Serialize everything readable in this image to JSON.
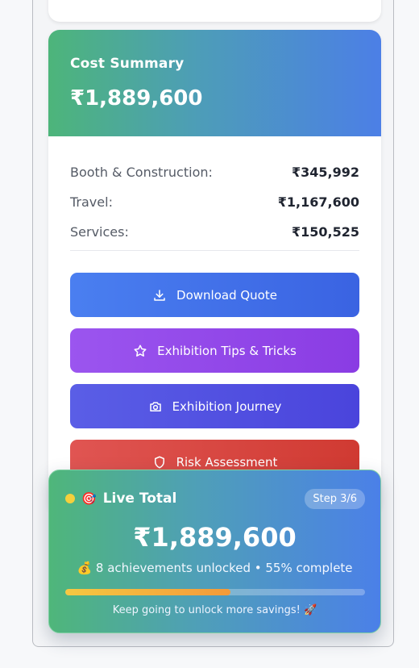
{
  "cost_summary": {
    "title": "Cost Summary",
    "total": "₹1,889,600",
    "items": [
      {
        "label": "Booth & Construction:",
        "value": "₹345,992"
      },
      {
        "label": "Travel:",
        "value": "₹1,167,600"
      },
      {
        "label": "Services:",
        "value": "₹150,525"
      }
    ]
  },
  "buttons": {
    "download": {
      "label": "Download Quote",
      "icon": "download-icon"
    },
    "tips": {
      "label": "Exhibition Tips & Tricks",
      "icon": "star-icon"
    },
    "journey": {
      "label": "Exhibition Journey",
      "icon": "camera-icon"
    },
    "risk": {
      "label": "Risk Assessment",
      "icon": "shield-icon"
    }
  },
  "live_total": {
    "icon": "🎯",
    "label": "Live Total",
    "step": "Step 3/6",
    "total": "₹1,889,600",
    "stats_icon": "💰",
    "stats": "8 achievements unlocked • 55% complete",
    "progress_percent": 55,
    "note": "Keep going to unlock more savings! 🚀"
  },
  "colors": {
    "header_gradient_start": "#4db57a",
    "header_gradient_end": "#4c7fe6",
    "download_button": "#4a7ff0",
    "tips_button": "#9b55ef",
    "journey_button": "#5a5ee6",
    "risk_button": "#e05552",
    "progress_fill": "#f5c842",
    "status_dot": "#f5d03c"
  }
}
